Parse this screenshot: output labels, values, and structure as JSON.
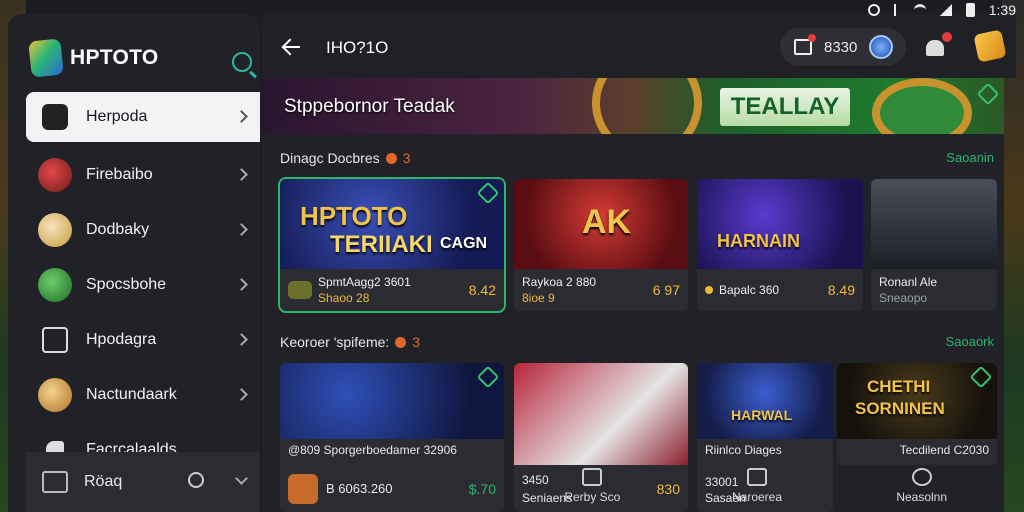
{
  "status_bar": {
    "time": "1:39"
  },
  "brand": {
    "name": "HPTOTO"
  },
  "sidebar": {
    "items": [
      {
        "label": "Herpoda",
        "icon": "puzzle-icon"
      },
      {
        "label": "Firebaibo",
        "icon": "avatar"
      },
      {
        "label": "Dodbaky",
        "icon": "avatar"
      },
      {
        "label": "Spocsbohe",
        "icon": "avatar"
      },
      {
        "label": "Hpodagra",
        "icon": "card-icon"
      },
      {
        "label": "Nactundaark",
        "icon": "avatar"
      },
      {
        "label": "Facrcalaalds",
        "icon": "hand-icon"
      }
    ],
    "footer_label": "Röaq"
  },
  "header": {
    "title": "IHO?1O",
    "balance": "8330"
  },
  "banner": {
    "title": "Stppebornor Teadak",
    "cta": "TEALLAY"
  },
  "section1": {
    "title": "Dinagc Docbres",
    "count": "3",
    "see_all": "Saoanin",
    "cards": [
      {
        "big1": "HPTOTO",
        "big2": "TERIIAKI",
        "big3": "CAGN",
        "line1": "SpmtAagg2 3601",
        "line2": "Shaoo 28",
        "price": "8.42"
      },
      {
        "big1": "AK",
        "line1": "Raykoa 2 880",
        "line2": "8ioe 9",
        "price": "6 97"
      },
      {
        "big1": "HARNAIN",
        "line1": "Bapalc 360",
        "price": "8.49"
      },
      {
        "line1": "Ronanl Ale",
        "line2": "Sneaopo"
      }
    ]
  },
  "section2": {
    "title": "Keoroer 'spifeme:",
    "count": "3",
    "see_all": "Saoaork",
    "cards": [
      {
        "line1": "@809 Sporgerboedamer 32906",
        "line2": "B 6063.260",
        "price": "$.70"
      },
      {
        "line1": "3450",
        "line2": "Seniaens",
        "price": "830"
      },
      {
        "big1": "HARWAL",
        "line1": "Riinlco Diages",
        "line2": "33001",
        "line3": "Sasaen"
      },
      {
        "big1": "CHETHI",
        "big2": "SORNINEN",
        "line1": "Tecdilend C2030"
      }
    ]
  },
  "bottom_nav": [
    {
      "label": "Rerby Sco"
    },
    {
      "label": "Naroerea"
    },
    {
      "label": "Neasolnn"
    }
  ]
}
